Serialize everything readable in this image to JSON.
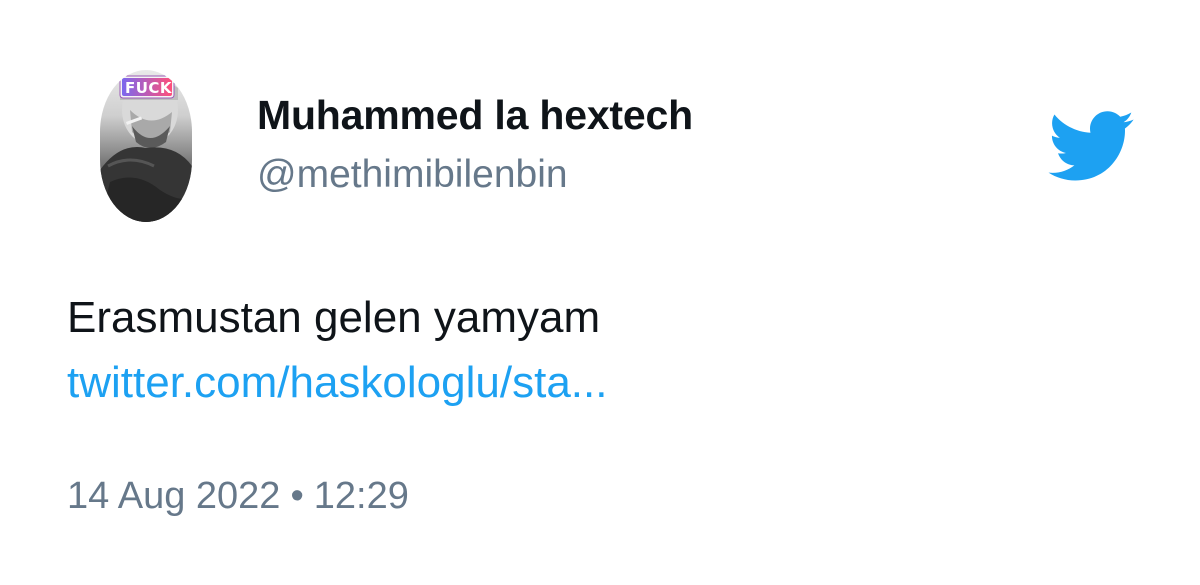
{
  "author": {
    "display_name": "Muhammed la hextech",
    "handle": "@methimibilenbin",
    "avatar_badge_text": "FUCK"
  },
  "tweet": {
    "text": "Erasmustan gelen yamyam",
    "link_text": "twitter.com/haskologlu/sta...",
    "date": "14 Aug 2022",
    "separator": "•",
    "time": "12:29"
  },
  "brand": {
    "logo_icon": "twitter-bird-icon",
    "color": "#1da1f2"
  },
  "colors": {
    "text_primary": "#0f1419",
    "text_secondary": "#66788a",
    "link": "#1da1f2"
  }
}
